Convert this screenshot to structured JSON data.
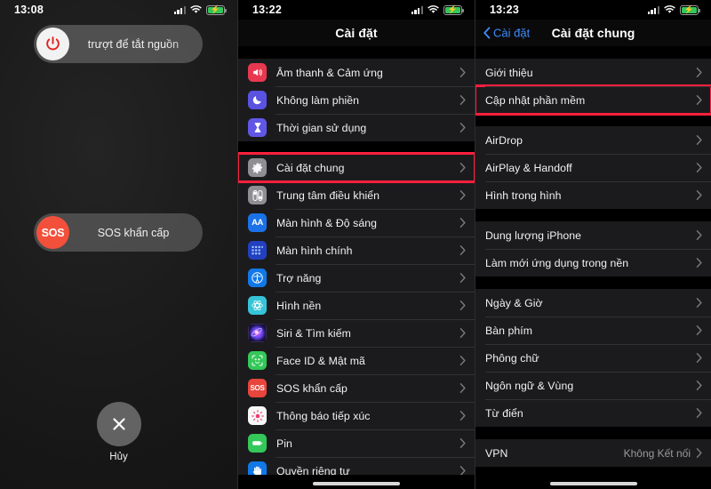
{
  "colors": {
    "accent_red": "#fb2c41",
    "link_blue": "#3f8cff",
    "row_bg": "#1b1b1d",
    "battery_green": "#34c759"
  },
  "panel_power": {
    "status": {
      "time": "13:08",
      "cellular": "signal-bars",
      "wifi": "wifi-icon",
      "battery": "battery-charging"
    },
    "power_slider": {
      "label": "trượt để tắt nguồn",
      "knob_icon": "power-icon"
    },
    "sos_slider": {
      "label": "SOS khẩn cấp",
      "knob_label": "SOS"
    },
    "cancel": {
      "label": "Hủy",
      "icon": "close-icon"
    }
  },
  "panel_settings": {
    "status": {
      "time": "13:22",
      "cellular": "signal-bars",
      "wifi": "wifi-icon",
      "battery": "battery-charging"
    },
    "title": "Cài đặt",
    "groups": [
      {
        "rows": [
          {
            "label": "Âm thanh & Cảm ứng",
            "icon": "speaker-icon",
            "icon_color": "#e8384f",
            "highlight": false
          },
          {
            "label": "Không làm phiền",
            "icon": "moon-icon",
            "icon_color": "#5a52e0",
            "highlight": false
          },
          {
            "label": "Thời gian sử dụng",
            "icon": "hourglass-icon",
            "icon_color": "#6157e6",
            "highlight": false
          }
        ]
      },
      {
        "rows": [
          {
            "label": "Cài đặt chung",
            "icon": "gear-icon",
            "icon_color": "#8e8e93",
            "highlight": true
          },
          {
            "label": "Trung tâm điều khiển",
            "icon": "sliders-icon",
            "icon_color": "#8e8e93",
            "highlight": false
          },
          {
            "label": "Màn hình & Độ sáng",
            "icon": "aa-icon",
            "icon_color": "#1b72e8",
            "highlight": false
          },
          {
            "label": "Màn hình chính",
            "icon": "grid-icon",
            "icon_color": "#2340c0",
            "highlight": false
          },
          {
            "label": "Trợ năng",
            "icon": "accessibility-icon",
            "icon_color": "#1178e8",
            "highlight": false
          },
          {
            "label": "Hình nền",
            "icon": "wallpaper-icon",
            "icon_color": "#35c4d8",
            "highlight": false
          },
          {
            "label": "Siri & Tìm kiếm",
            "icon": "siri-icon",
            "icon_color": "#3a2a5c",
            "highlight": false
          },
          {
            "label": "Face ID & Mật mã",
            "icon": "faceid-icon",
            "icon_color": "#34c759",
            "highlight": false
          },
          {
            "label": "SOS khẩn cấp",
            "icon": "sos-icon",
            "icon_color": "#e8453c",
            "highlight": false
          },
          {
            "label": "Thông báo tiếp xúc",
            "icon": "exposure-icon",
            "icon_color": "#f7f7f7",
            "highlight": false
          },
          {
            "label": "Pin",
            "icon": "battery-icon",
            "icon_color": "#34c759",
            "highlight": false
          },
          {
            "label": "Quyền riêng tư",
            "icon": "hand-icon",
            "icon_color": "#1178e8",
            "highlight": false
          }
        ]
      }
    ]
  },
  "panel_general": {
    "status": {
      "time": "13:23",
      "cellular": "signal-bars",
      "wifi": "wifi-icon",
      "battery": "battery-charging"
    },
    "back_label": "Cài đặt",
    "title": "Cài đặt chung",
    "groups": [
      {
        "rows": [
          {
            "label": "Giới thiệu",
            "value": "",
            "highlight": false
          },
          {
            "label": "Cập nhật phần mềm",
            "value": "",
            "highlight": true
          }
        ]
      },
      {
        "rows": [
          {
            "label": "AirDrop",
            "value": "",
            "highlight": false
          },
          {
            "label": "AirPlay & Handoff",
            "value": "",
            "highlight": false
          },
          {
            "label": "Hình trong hình",
            "value": "",
            "highlight": false
          }
        ]
      },
      {
        "rows": [
          {
            "label": "Dung lượng iPhone",
            "value": "",
            "highlight": false
          },
          {
            "label": "Làm mới ứng dụng trong nền",
            "value": "",
            "highlight": false
          }
        ]
      },
      {
        "rows": [
          {
            "label": "Ngày & Giờ",
            "value": "",
            "highlight": false
          },
          {
            "label": "Bàn phím",
            "value": "",
            "highlight": false
          },
          {
            "label": "Phông chữ",
            "value": "",
            "highlight": false
          },
          {
            "label": "Ngôn ngữ & Vùng",
            "value": "",
            "highlight": false
          },
          {
            "label": "Từ điển",
            "value": "",
            "highlight": false
          }
        ]
      },
      {
        "rows": [
          {
            "label": "VPN",
            "value": "Không Kết nối",
            "highlight": false
          }
        ]
      }
    ]
  }
}
